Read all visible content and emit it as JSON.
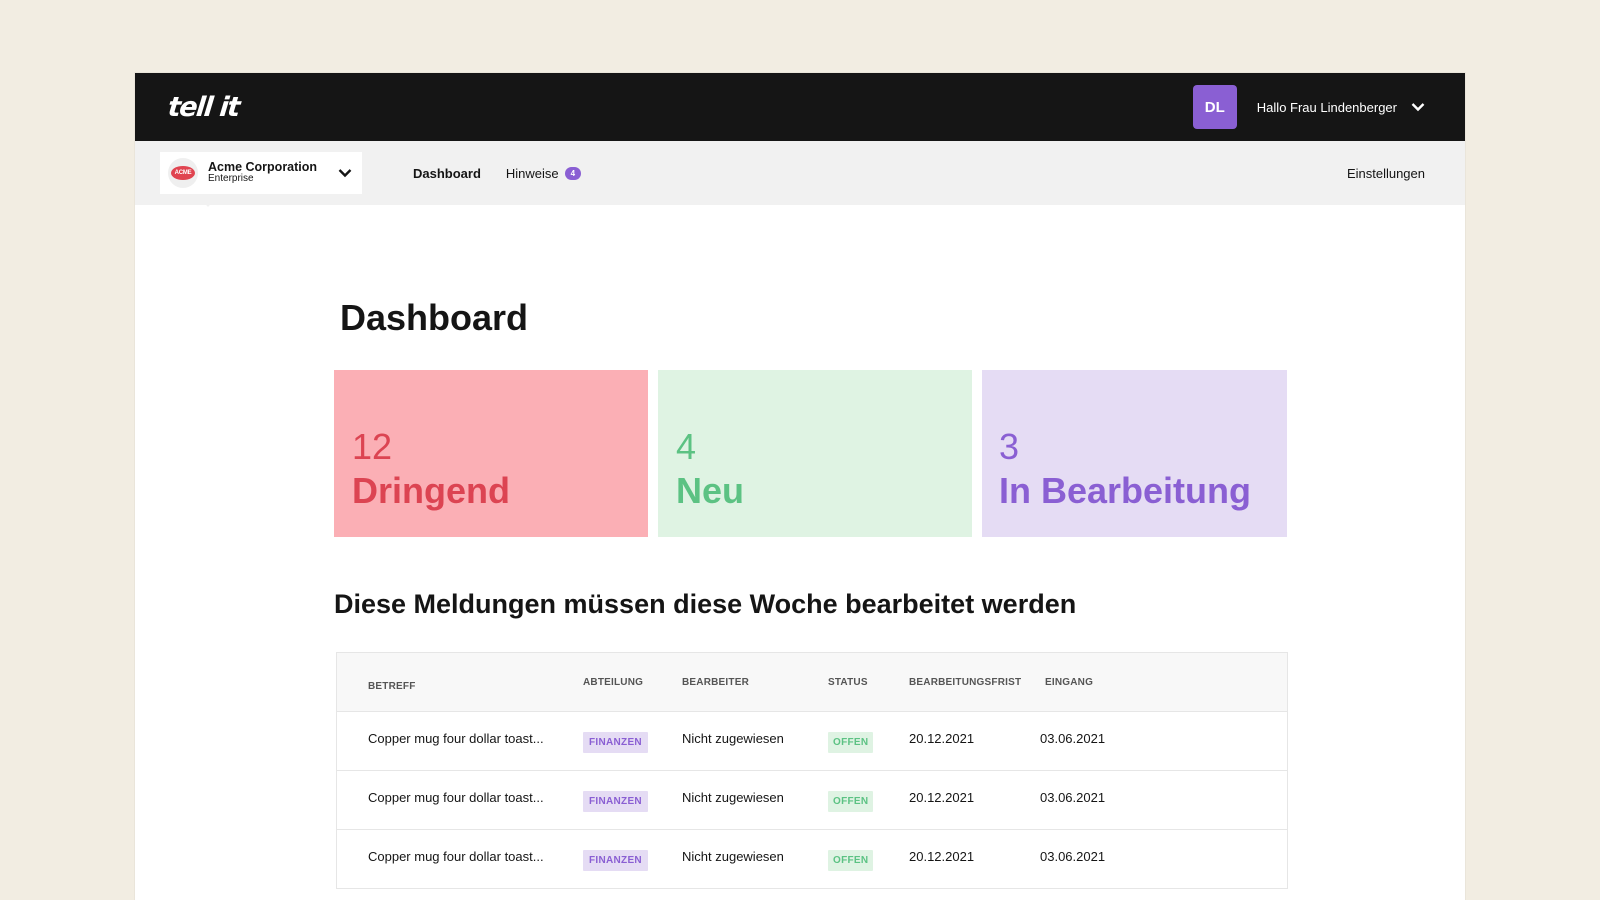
{
  "app": {
    "logo_text": "tell it"
  },
  "header": {
    "avatar_initials": "DL",
    "greeting": "Hallo Frau Lindenberger",
    "avatar_color": "#8a5fd3"
  },
  "org": {
    "logo_text": "ACME",
    "name": "Acme Corporation",
    "plan": "Enterprise"
  },
  "nav": {
    "items": [
      {
        "label": "Dashboard",
        "active": true
      },
      {
        "label": "Hinweise",
        "badge": "4"
      }
    ],
    "settings_label": "Einstellungen"
  },
  "page": {
    "title": "Dashboard"
  },
  "cards": [
    {
      "count": "12",
      "label": "Dringend",
      "bg": "#fbafb5",
      "fg": "#dc4452"
    },
    {
      "count": "4",
      "label": "Neu",
      "bg": "#dff3e3",
      "fg": "#5cc283"
    },
    {
      "count": "3",
      "label": "In Bearbeitung",
      "bg": "#e5dcf4",
      "fg": "#8a5fd3"
    }
  ],
  "section": {
    "title": "Diese Meldungen müssen diese Woche bearbeitet werden"
  },
  "table": {
    "headers": {
      "subject": "BETREFF",
      "department": "ABTEILUNG",
      "editor": "BEARBEITER",
      "status": "STATUS",
      "deadline": "BEARBEITUNGSFRIST",
      "inbox": "EINGANG"
    },
    "rows": [
      {
        "subject": "Copper mug four dollar toast...",
        "department": "FINANZEN",
        "editor": "Nicht zugewiesen",
        "status": "OFFEN",
        "deadline": "20.12.2021",
        "inbox": "03.06.2021"
      },
      {
        "subject": "Copper mug four dollar toast...",
        "department": "FINANZEN",
        "editor": "Nicht zugewiesen",
        "status": "OFFEN",
        "deadline": "20.12.2021",
        "inbox": "03.06.2021"
      },
      {
        "subject": "Copper mug four dollar toast...",
        "department": "FINANZEN",
        "editor": "Nicht zugewiesen",
        "status": "OFFEN",
        "deadline": "20.12.2021",
        "inbox": "03.06.2021"
      }
    ]
  }
}
